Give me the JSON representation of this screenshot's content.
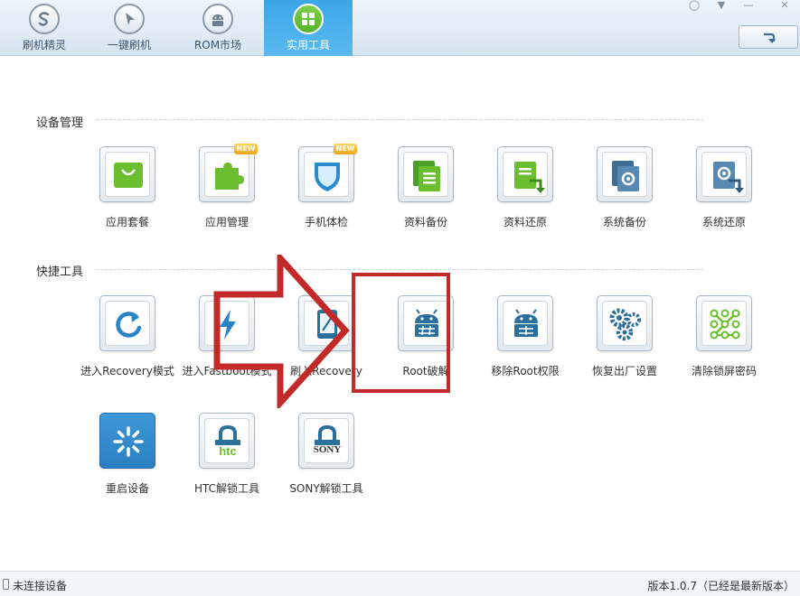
{
  "nav": {
    "tabs": [
      {
        "label": "刷机精灵",
        "icon": "s-logo-icon"
      },
      {
        "label": "一键刷机",
        "icon": "play-icon"
      },
      {
        "label": "ROM市场",
        "icon": "android-icon"
      },
      {
        "label": "实用工具",
        "icon": "grid-icon",
        "active": true
      }
    ]
  },
  "sections": {
    "device": {
      "title": "设备管理",
      "items": [
        {
          "label": "应用套餐",
          "icon": "shopping-bag-icon"
        },
        {
          "label": "应用管理",
          "icon": "puzzle-icon",
          "badge": "NEW"
        },
        {
          "label": "手机体检",
          "icon": "shield-icon",
          "badge": "NEW"
        },
        {
          "label": "资料备份",
          "icon": "document-backup-icon"
        },
        {
          "label": "资料还原",
          "icon": "document-restore-icon"
        },
        {
          "label": "系统备份",
          "icon": "system-backup-icon"
        },
        {
          "label": "系统还原",
          "icon": "system-restore-icon"
        }
      ]
    },
    "quick": {
      "title": "快捷工具",
      "items": [
        {
          "label": "进入Recovery模式",
          "icon": "refresh-icon"
        },
        {
          "label": "进入Fastboot模式",
          "icon": "lightning-icon"
        },
        {
          "label": "刷入Recovery",
          "icon": "tablet-edit-icon"
        },
        {
          "label": "Root破解",
          "icon": "android-root-icon"
        },
        {
          "label": "移除Root权限",
          "icon": "android-unroot-icon"
        },
        {
          "label": "恢复出厂设置",
          "icon": "gears-icon"
        },
        {
          "label": "清除锁屏密码",
          "icon": "pattern-lock-icon"
        },
        {
          "label": "重启设备",
          "icon": "restart-icon"
        },
        {
          "label": "HTC解锁工具",
          "icon": "htc-lock-icon",
          "brand": "htc"
        },
        {
          "label": "SONY解锁工具",
          "icon": "sony-lock-icon",
          "brand": "SONY"
        }
      ]
    }
  },
  "status": {
    "connection": "未连接设备",
    "version": "版本1.0.7（已经是最新版本）"
  },
  "colors": {
    "accent": "#3ba6e8",
    "green": "#6bbf2e",
    "annotation": "#c22a2a"
  }
}
